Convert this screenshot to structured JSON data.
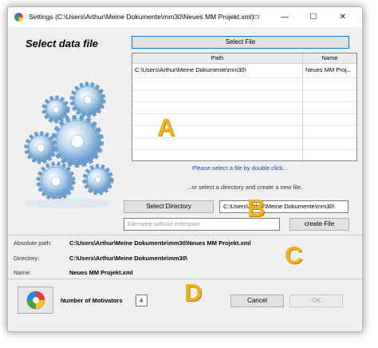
{
  "window": {
    "title": "Settings (C:\\Users\\Arthur\\Meine Dokumente\\mm30\\Neues MM Projekt.xml)",
    "controls": {
      "extra": "▭",
      "minimize": "—",
      "maximize": "☐",
      "close": "✕"
    }
  },
  "left": {
    "heading": "Select data file"
  },
  "file_section": {
    "select_file_label": "Select File",
    "table": {
      "columns": [
        "Path",
        "Name"
      ],
      "rows": [
        {
          "path": "C:\\Users\\Arthur\\Meine Dokumente\\mm30\\",
          "name": "Neues MM Proj..."
        }
      ]
    },
    "hint": "Please select a file by double click..."
  },
  "directory_section": {
    "hint": "...or select a directory and create a new file..",
    "select_directory_label": "Select Directory",
    "directory_value": "C:\\Users\\Arthur\\Meine Dokumente\\mm30\\",
    "filename_placeholder": "Filename without extension",
    "create_file_label": "create File"
  },
  "info": {
    "absolute_path_label": "Absolute path:",
    "absolute_path_value": "C:\\Users\\Arthur\\Meine Dokumente\\mm30\\Neues MM Projekt.xml",
    "directory_label": "Directory:",
    "directory_value": "C:\\Users\\Arthur\\Meine Dokumente\\mm30\\",
    "name_label": "Name:",
    "name_value": "Neues MM Projekt.xml"
  },
  "footer": {
    "motivators_label": "Number of Motivators",
    "motivators_value": "4",
    "cancel_label": "Cancel",
    "ok_label": "OK"
  },
  "annotations": {
    "a": "A",
    "b": "B",
    "c": "C",
    "d": "D"
  },
  "colors": {
    "accent": "#0078d7",
    "hint_link": "#1f3fd0",
    "annotation": "#f2b11b"
  },
  "icons": [
    "app-logo-icon",
    "gears-illustration",
    "motivator-wheel-icon"
  ]
}
